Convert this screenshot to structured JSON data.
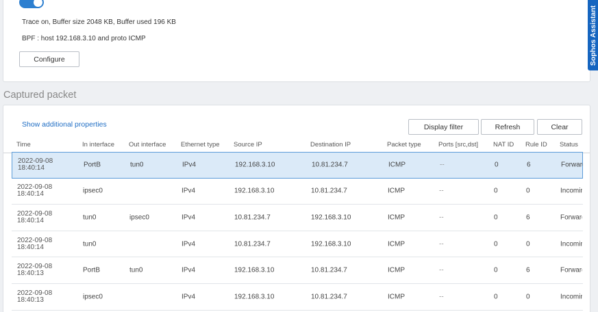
{
  "trace": {
    "status_line": "Trace on, Buffer size 2048 KB, Buffer used 196 KB",
    "bpf_line": "BPF : host 192.168.3.10 and proto ICMP",
    "configure_label": "Configure"
  },
  "side_tab": {
    "label": "Sophos Assistant"
  },
  "section": {
    "title": "Captured packet"
  },
  "table_toolbar": {
    "show_props_label": "Show additional properties",
    "display_filter_label": "Display filter",
    "refresh_label": "Refresh",
    "clear_label": "Clear"
  },
  "columns": [
    "Time",
    "In interface",
    "Out interface",
    "Ethernet type",
    "Source IP",
    "Destination IP",
    "Packet type",
    "Ports [src,dst]",
    "NAT ID",
    "Rule ID",
    "Status"
  ],
  "rows": [
    {
      "date": "2022-09-08",
      "time": "18:40:14",
      "in": "PortB",
      "out": "tun0",
      "eth": "IPv4",
      "src": "192.168.3.10",
      "dst": "10.81.234.7",
      "ptype": "ICMP",
      "ports": "--",
      "nat": "0",
      "rule": "6",
      "status": "Forwarded"
    },
    {
      "date": "2022-09-08",
      "time": "18:40:14",
      "in": "ipsec0",
      "out": "",
      "eth": "IPv4",
      "src": "192.168.3.10",
      "dst": "10.81.234.7",
      "ptype": "ICMP",
      "ports": "--",
      "nat": "0",
      "rule": "0",
      "status": "Incoming"
    },
    {
      "date": "2022-09-08",
      "time": "18:40:14",
      "in": "tun0",
      "out": "ipsec0",
      "eth": "IPv4",
      "src": "10.81.234.7",
      "dst": "192.168.3.10",
      "ptype": "ICMP",
      "ports": "--",
      "nat": "0",
      "rule": "6",
      "status": "Forwarded"
    },
    {
      "date": "2022-09-08",
      "time": "18:40:14",
      "in": "tun0",
      "out": "",
      "eth": "IPv4",
      "src": "10.81.234.7",
      "dst": "192.168.3.10",
      "ptype": "ICMP",
      "ports": "--",
      "nat": "0",
      "rule": "0",
      "status": "Incoming"
    },
    {
      "date": "2022-09-08",
      "time": "18:40:13",
      "in": "PortB",
      "out": "tun0",
      "eth": "IPv4",
      "src": "192.168.3.10",
      "dst": "10.81.234.7",
      "ptype": "ICMP",
      "ports": "--",
      "nat": "0",
      "rule": "6",
      "status": "Forwarded"
    },
    {
      "date": "2022-09-08",
      "time": "18:40:13",
      "in": "ipsec0",
      "out": "",
      "eth": "IPv4",
      "src": "192.168.3.10",
      "dst": "10.81.234.7",
      "ptype": "ICMP",
      "ports": "--",
      "nat": "0",
      "rule": "0",
      "status": "Incoming"
    }
  ],
  "selected_row": 0,
  "colors": {
    "accent": "#2d7fd0",
    "link": "#1e6dc4",
    "side_tab": "#1565c0",
    "selected_bg": "#dbeaf8"
  }
}
